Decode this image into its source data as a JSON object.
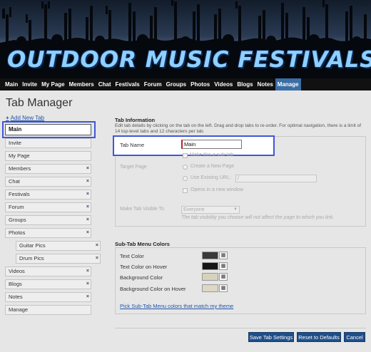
{
  "banner": {
    "title": "OUTDOOR MUSIC FESTIVALS"
  },
  "nav": {
    "items": [
      "Main",
      "Invite",
      "My Page",
      "Members",
      "Chat",
      "Festivals",
      "Forum",
      "Groups",
      "Photos",
      "Videos",
      "Blogs",
      "Notes",
      "Manage"
    ],
    "active": "Manage"
  },
  "page": {
    "title": "Tab Manager"
  },
  "sidebar": {
    "add_tab_label": "Add New Tab",
    "editing_tab": "Main",
    "tabs": [
      {
        "label": "Invite",
        "removable": false
      },
      {
        "label": "My Page",
        "removable": false
      },
      {
        "label": "Members",
        "removable": true
      },
      {
        "label": "Chat",
        "removable": true
      },
      {
        "label": "Festivals",
        "removable": true
      },
      {
        "label": "Forum",
        "removable": true
      },
      {
        "label": "Groups",
        "removable": true
      },
      {
        "label": "Photos",
        "removable": true
      },
      {
        "label": "Guitar Pics",
        "removable": true,
        "sub": true
      },
      {
        "label": "Drum Pics",
        "removable": true,
        "sub": true
      },
      {
        "label": "Videos",
        "removable": true
      },
      {
        "label": "Blogs",
        "removable": true
      },
      {
        "label": "Notes",
        "removable": true
      },
      {
        "label": "Manage",
        "removable": false
      }
    ]
  },
  "tab_info": {
    "title": "Tab Information",
    "description": "Edit tab details by clicking on the tab on the left. Drag and drop tabs to re-order. For optimal navigation, there is a limit of 14 top-level tabs and 12 characters per tab.",
    "tab_name_label": "Tab Name",
    "tab_name_value": "Main",
    "make_sub_tab": "Make this a sub-tab",
    "target_page_label": "Target Page",
    "create_new_page": "Create a New Page",
    "use_existing_url": "Use Existing URL:",
    "url_value": "/",
    "open_new_window": "Opens in a new window",
    "visible_to_label": "Make Tab Visible To",
    "visible_to_value": "Everyone",
    "visibility_note": "The tab visibility you choose will not affect the page to which you link."
  },
  "subtab_colors": {
    "title": "Sub-Tab Menu Colors",
    "rows": [
      {
        "label": "Text Color",
        "color": "#3a3a3a"
      },
      {
        "label": "Text Color on Hover",
        "color": "#161616"
      },
      {
        "label": "Background Color",
        "color": "#d7d2bc"
      },
      {
        "label": "Background Color on Hover",
        "color": "#ddd8c6"
      }
    ],
    "pick_link": "Pick Sub-Tab Menu colors that match my theme"
  },
  "buttons": {
    "save": "Save Tab Settings",
    "reset": "Reset to Defaults",
    "cancel": "Cancel"
  },
  "colors": {
    "nav_active": "#3a6ea5",
    "button": "#1f4f8a",
    "highlight": "#3f57d6",
    "link": "#2255aa"
  }
}
